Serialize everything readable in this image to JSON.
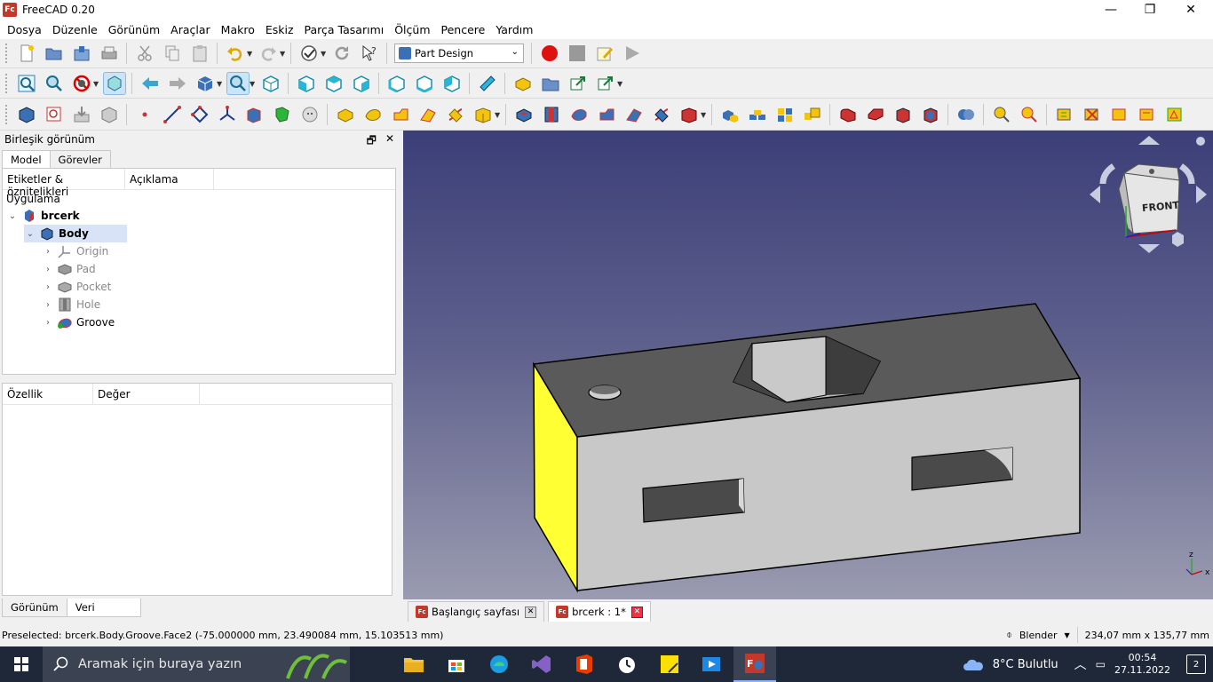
{
  "window": {
    "title": "FreeCAD 0.20",
    "icon": "freecad-icon",
    "minimize": "—",
    "maximize": "❐",
    "close": "✕"
  },
  "menu": [
    "Dosya",
    "Düzenle",
    "Görünüm",
    "Araçlar",
    "Makro",
    "Eskiz",
    "Parça Tasarımı",
    "Ölçüm",
    "Pencere",
    "Yardım"
  ],
  "workbench": {
    "selected": "Part Design"
  },
  "combo_view": {
    "title": "Birleşik görünüm",
    "tabs": [
      "Model",
      "Görevler"
    ],
    "tree_columns": [
      "Etiketler & öznitelikleri",
      "Açıklama"
    ],
    "application_label": "Uygulama",
    "document": "brcerk",
    "body": "Body",
    "features": [
      "Origin",
      "Pad",
      "Pocket",
      "Hole",
      "Groove"
    ],
    "property_columns": [
      "Özellik",
      "Değer"
    ],
    "bottom_tabs": [
      "Görünüm",
      "Veri"
    ]
  },
  "doc_tabs": [
    {
      "label": "Başlangıç sayfası",
      "selected": false
    },
    {
      "label": "brcerk : 1*",
      "selected": true
    }
  ],
  "navcube": {
    "face_label": "FRONT"
  },
  "axis": {
    "z": "z",
    "x": "x"
  },
  "statusbar": {
    "message": "Preselected: brcerk.Body.Groove.Face2 (-75.000000 mm, 23.490084 mm, 15.103513 mm)",
    "nav_style": "Blender",
    "dimensions": "234,07 mm x 135,77 mm"
  },
  "taskbar": {
    "search_placeholder": "Aramak için buraya yazın",
    "weather": "8°C  Bulutlu",
    "time": "00:54",
    "date": "27.11.2022",
    "notifications": "2"
  },
  "colors": {
    "selection_face": "#ffff33",
    "model_grey": "#c8c8c8",
    "background_top": "#3c3f78",
    "background_bottom": "#9a9bb0"
  }
}
